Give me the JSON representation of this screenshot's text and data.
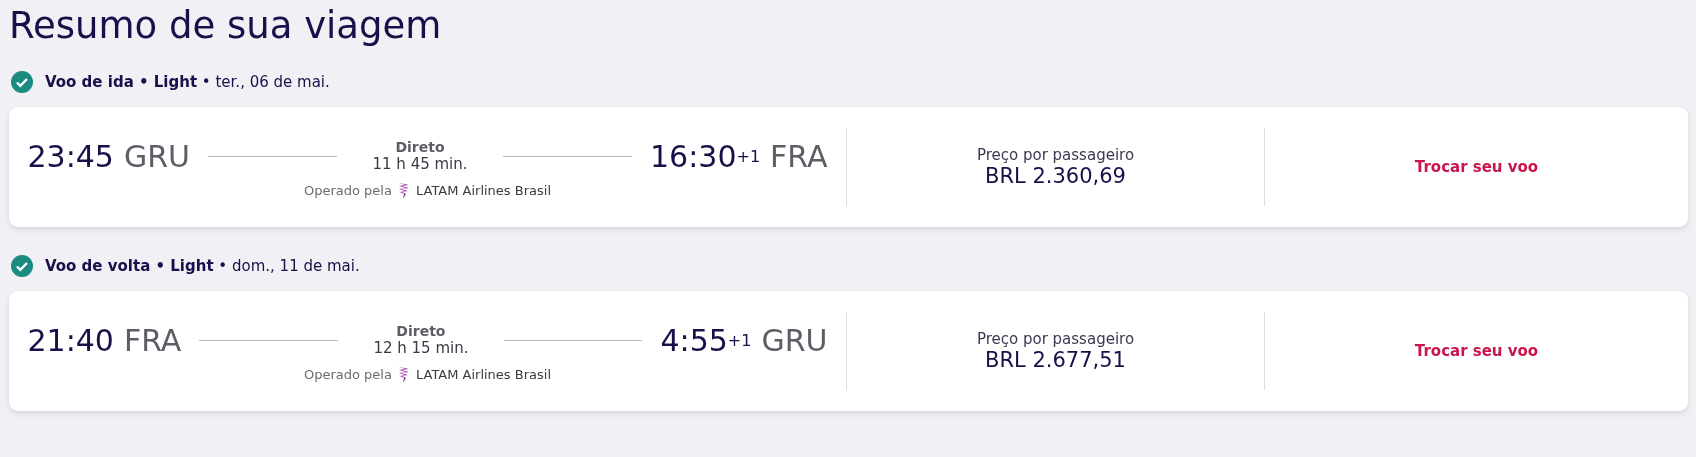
{
  "title": "Resumo de sua viagem",
  "flights": [
    {
      "confirmed": true,
      "heading": "**Voo de ida • Light** • ter., 06 de mai.",
      "departure_time": "23:45",
      "departure_airport": "GRU",
      "stops": "Direto",
      "duration": "11 h 45 min.",
      "arrival_time": "16:30",
      "day_offset": "+1",
      "arrival_airport": "FRA",
      "operated_label": "Operado pela",
      "airline": "LATAM Airlines Brasil",
      "price_label": "Preço por passageiro",
      "price": "BRL 2.360,69",
      "action": "Trocar seu voo"
    },
    {
      "confirmed": true,
      "heading": "**Voo de volta • Light** • dom., 11 de mai.",
      "departure_time": "21:40",
      "departure_airport": "FRA",
      "stops": "Direto",
      "duration": "12 h 15 min.",
      "arrival_time": "4:55",
      "day_offset": "+1",
      "arrival_airport": "GRU",
      "operated_label": "Operado pela",
      "airline": "LATAM Airlines Brasil",
      "price_label": "Preço por passageiro",
      "price": "BRL 2.677,51",
      "action": "Trocar seu voo"
    }
  ]
}
